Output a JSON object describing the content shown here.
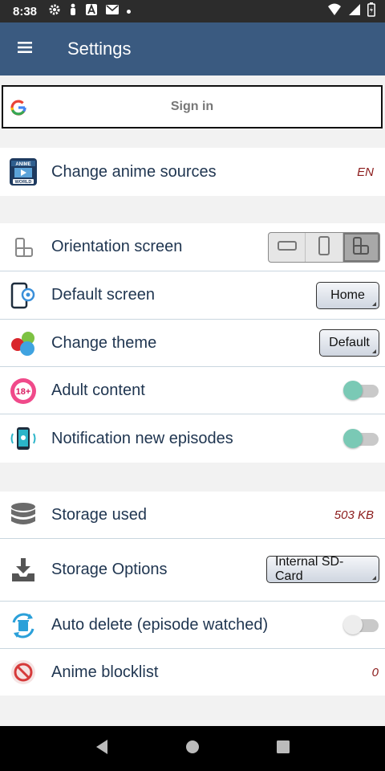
{
  "status_bar": {
    "time": "8:38"
  },
  "app_bar": {
    "title": "Settings"
  },
  "signin": {
    "label": "Sign in"
  },
  "sources_group": [
    {
      "label": "Change anime sources",
      "value": "EN",
      "icon": "anime-world-icon"
    }
  ],
  "preferences_group": {
    "orientation": {
      "label": "Orientation screen",
      "options": [
        "landscape",
        "portrait",
        "auto-rotate"
      ],
      "selected": "auto-rotate"
    },
    "default_screen": {
      "label": "Default screen",
      "value": "Home"
    },
    "theme": {
      "label": "Change theme",
      "value": "Default"
    },
    "adult": {
      "label": "Adult content",
      "enabled": true
    },
    "notification": {
      "label": "Notification new episodes",
      "enabled": true
    }
  },
  "storage_group": {
    "storage_used": {
      "label": "Storage used",
      "value": "503 KB"
    },
    "storage_options": {
      "label": "Storage Options",
      "value": "Internal SD-Card"
    },
    "auto_delete": {
      "label": "Auto delete (episode watched)",
      "enabled": false
    },
    "blocklist": {
      "label": "Anime blocklist",
      "value": "0"
    }
  },
  "colors": {
    "app_bar": "#3a5a80",
    "status_bar": "#2c2c2c",
    "label": "#1f3550",
    "value": "#8b1a1a",
    "toggle_on": "#7ac9b5",
    "divider": "#c9d6df"
  }
}
